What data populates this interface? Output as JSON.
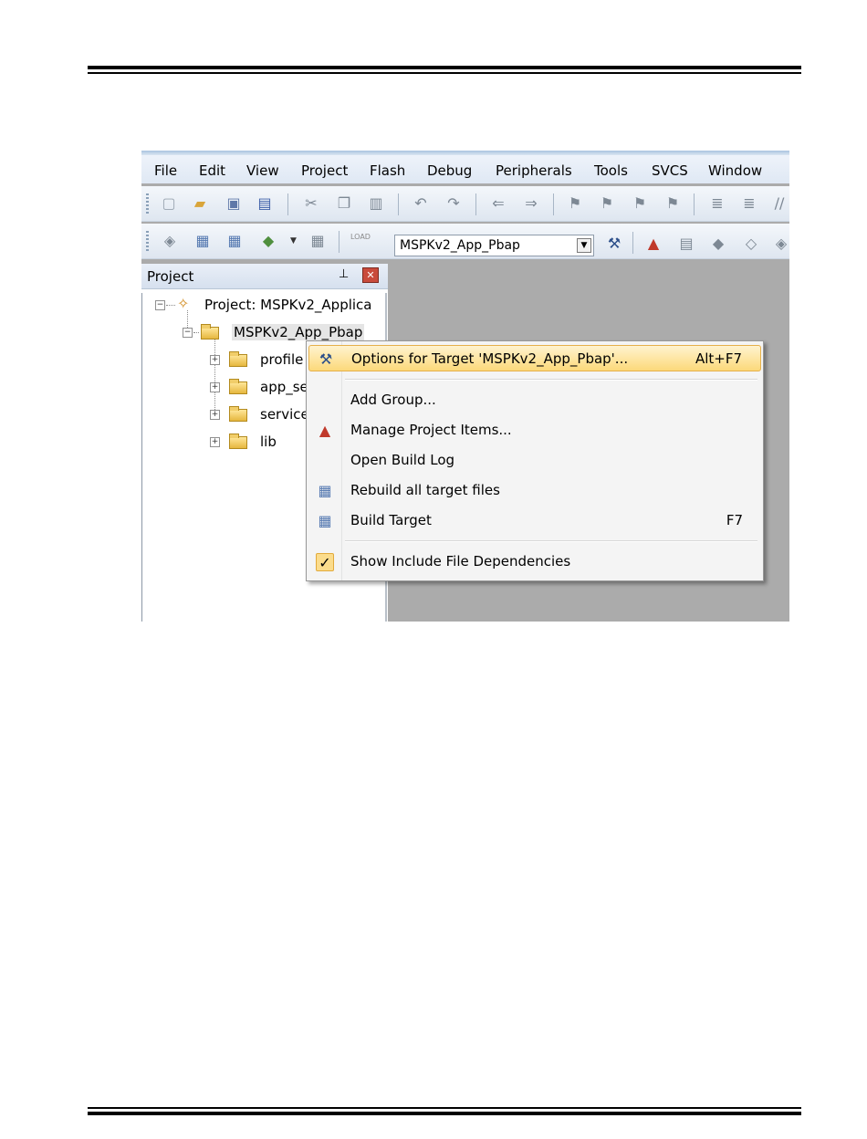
{
  "menubar": {
    "items": [
      "File",
      "Edit",
      "View",
      "Project",
      "Flash",
      "Debug",
      "Peripherals",
      "Tools",
      "SVCS",
      "Window"
    ]
  },
  "build_toolbar": {
    "target_select": {
      "value": "MSPKv2_App_Pbap"
    },
    "load_icon_text": "LOAD"
  },
  "project_panel": {
    "title": "Project",
    "tree": {
      "root": "Project: MSPKv2_Applica",
      "target": "MSPKv2_App_Pbap",
      "groups": [
        "profile",
        "app_se",
        "service",
        "lib"
      ]
    }
  },
  "context_menu": {
    "items": [
      {
        "label": "Options for Target 'MSPKv2_App_Pbap'...",
        "shortcut": "Alt+F7",
        "highlighted": true,
        "icon": "magic-wand-icon"
      },
      {
        "label": "Add Group...",
        "shortcut": "",
        "icon": ""
      },
      {
        "label": "Manage Project Items...",
        "shortcut": "",
        "icon": "manage-items-icon"
      },
      {
        "label": "Open Build Log",
        "shortcut": "",
        "icon": ""
      },
      {
        "label": "Rebuild all target files",
        "shortcut": "",
        "icon": "rebuild-icon"
      },
      {
        "label": "Build Target",
        "shortcut": "F7",
        "icon": "build-icon"
      },
      {
        "label": "Show Include File Dependencies",
        "shortcut": "",
        "checked": true,
        "icon": "checkmark-icon"
      }
    ]
  },
  "colors": {
    "workspace": "#ababab",
    "menu_highlight": "#fcd97a",
    "menubar": "#dfe8f4"
  }
}
